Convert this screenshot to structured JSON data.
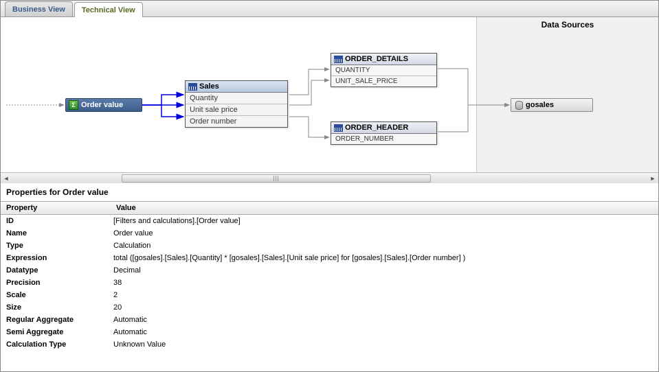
{
  "tabs": {
    "business": "Business View",
    "technical": "Technical View"
  },
  "canvas": {
    "dataSourcesTitle": "Data Sources",
    "orderValue": {
      "label": "Order value"
    },
    "sales": {
      "title": "Sales",
      "rows": [
        "Quantity",
        "Unit sale price",
        "Order number"
      ]
    },
    "orderDetails": {
      "title": "ORDER_DETAILS",
      "rows": [
        "QUANTITY",
        "UNIT_SALE_PRICE"
      ]
    },
    "orderHeader": {
      "title": "ORDER_HEADER",
      "rows": [
        "ORDER_NUMBER"
      ]
    },
    "gosales": {
      "label": "gosales"
    }
  },
  "properties": {
    "title": "Properties for Order value",
    "header": {
      "property": "Property",
      "value": "Value"
    },
    "rows": [
      {
        "k": "ID",
        "v": "[Filters and calculations].[Order value]"
      },
      {
        "k": "Name",
        "v": "Order value"
      },
      {
        "k": "Type",
        "v": "Calculation"
      },
      {
        "k": "Expression",
        "v": "total ([gosales].[Sales].[Quantity] * [gosales].[Sales].[Unit sale price] for [gosales].[Sales].[Order number] )"
      },
      {
        "k": "Datatype",
        "v": "Decimal"
      },
      {
        "k": "Precision",
        "v": "38"
      },
      {
        "k": "Scale",
        "v": "2"
      },
      {
        "k": "Size",
        "v": "20"
      },
      {
        "k": "Regular Aggregate",
        "v": "Automatic"
      },
      {
        "k": "Semi Aggregate",
        "v": "Automatic"
      },
      {
        "k": "Calculation Type",
        "v": "Unknown Value"
      }
    ]
  }
}
